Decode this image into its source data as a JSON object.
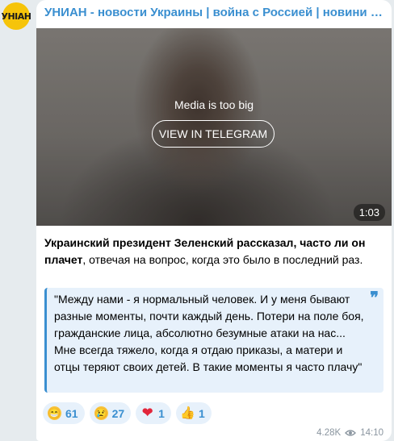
{
  "channel": {
    "logo_text": "УНІАН",
    "name": "УНИАН - новости Украины | война с Россией | новини Україні..."
  },
  "media": {
    "notice": "Media is too big",
    "view_button": "VIEW IN TELEGRAM",
    "duration": "1:03"
  },
  "post": {
    "bold_text": "Украинский президент Зеленский рассказал, часто ли он плачет",
    "rest_text": ", отвечая на вопрос, когда это было в последний раз.",
    "quote": "\"Между нами - я нормальный человек. И у меня бывают разные моменты, почти каждый день. Потери на поле боя, гражданские лица, абсолютно безумные атаки на нас... Мне всегда тяжело, когда я отдаю приказы, а матери и отцы теряют своих детей. В такие моменты я часто плачу\"",
    "quote_mark": "❞"
  },
  "reactions": [
    {
      "icon": "laughing-emoji-icon",
      "count": "61"
    },
    {
      "icon": "crying-emoji-icon",
      "count": "27"
    },
    {
      "icon": "heart-icon",
      "count": "1"
    },
    {
      "icon": "thumbs-up-icon",
      "count": "1"
    }
  ],
  "meta": {
    "views": "4.28K",
    "time": "14:10"
  },
  "colors": {
    "accent": "#3a8fd0",
    "background": "#e6ebee",
    "logo": "#f6c40a"
  }
}
